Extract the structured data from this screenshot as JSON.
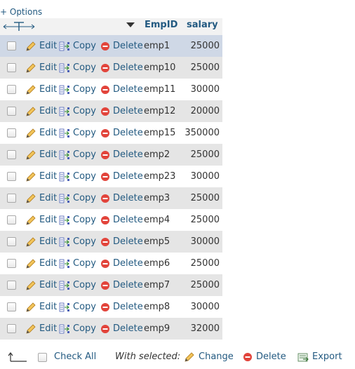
{
  "options_link": "+ Options",
  "columns": {
    "empid": "EmpID",
    "salary": "salary"
  },
  "actions": {
    "edit": "Edit",
    "copy": "Copy",
    "delete": "Delete"
  },
  "rows": [
    {
      "empid": "emp1",
      "salary": "25000"
    },
    {
      "empid": "emp10",
      "salary": "25000"
    },
    {
      "empid": "emp11",
      "salary": "30000"
    },
    {
      "empid": "emp12",
      "salary": "20000"
    },
    {
      "empid": "emp15",
      "salary": "350000"
    },
    {
      "empid": "emp2",
      "salary": "25000"
    },
    {
      "empid": "emp23",
      "salary": "30000"
    },
    {
      "empid": "emp3",
      "salary": "25000"
    },
    {
      "empid": "emp4",
      "salary": "25000"
    },
    {
      "empid": "emp5",
      "salary": "30000"
    },
    {
      "empid": "emp6",
      "salary": "25000"
    },
    {
      "empid": "emp7",
      "salary": "25000"
    },
    {
      "empid": "emp8",
      "salary": "30000"
    },
    {
      "empid": "emp9",
      "salary": "32000"
    }
  ],
  "footer": {
    "check_all": "Check All",
    "with_selected": "With selected:",
    "change": "Change",
    "delete": "Delete",
    "export": "Export"
  },
  "colors": {
    "link": "#235a81",
    "row_even": "#e5e5e5",
    "row_highlight": "#cfd8e6",
    "header_bg": "#f2f2f2",
    "delete_icon": "#e2443b",
    "pencil": "#e8a83a"
  }
}
